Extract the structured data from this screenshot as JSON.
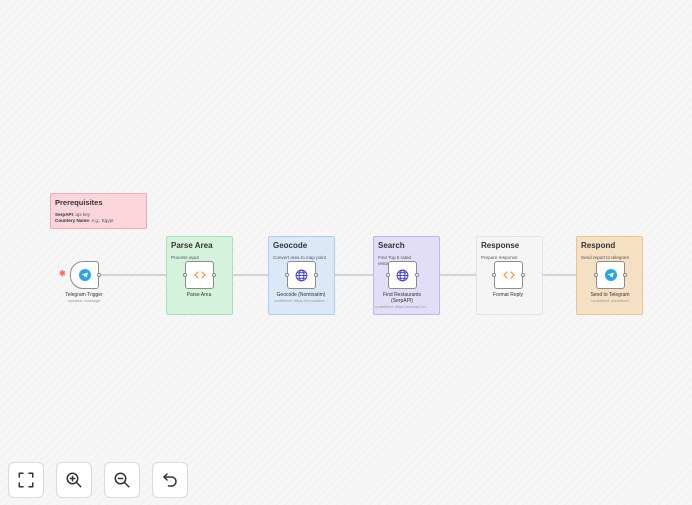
{
  "sticky_notes": {
    "prerequisites": {
      "title": "Prerequisites",
      "line1_label": "SerpAPI",
      "line1_value": ": api key",
      "line2_label": "Countery Name",
      "line2_value": ": e.g.,  Egypt"
    },
    "parse_area": {
      "title": "Parse Area",
      "subtitle": "Process input"
    },
    "geocode": {
      "title": "Geocode",
      "subtitle": "Convert area to map point"
    },
    "search": {
      "title": "Search",
      "subtitle": "Find Top 5 rated restaurants"
    },
    "response": {
      "title": "Response",
      "subtitle": "Prepare response"
    },
    "respond": {
      "title": "Respond",
      "subtitle": "Send report to telegram"
    }
  },
  "nodes": {
    "telegram_trigger": {
      "label": "Telegram Trigger",
      "subtitle": "updates: message",
      "icon": "telegram-icon"
    },
    "parse_area": {
      "label": "Parse Area",
      "icon": "code-icon"
    },
    "geocode": {
      "label": "Geocode (Nominatim)",
      "subtitle": "undefined: https://nominatim...",
      "icon": "globe-icon"
    },
    "find_restaurants": {
      "label_line1": "Find Restaurants",
      "label_line2": "(SerpAPI)",
      "subtitle": "undefined: https://serpapi.co...",
      "icon": "globe-icon"
    },
    "format_reply": {
      "label": "Format Reply",
      "icon": "code-icon"
    },
    "send_to_telegram": {
      "label": "Send to Telegram",
      "subtitle": "undefined: undefined",
      "icon": "telegram-icon"
    }
  },
  "controls": {
    "fit_view": "fit-view-icon",
    "zoom_in": "zoom-in-icon",
    "zoom_out": "zoom-out-icon",
    "undo": "undo-icon"
  },
  "colors": {
    "trigger_star": "#ff6d5a",
    "telegram": "#2ca5e0",
    "code": "#ff8a33",
    "globe": "#3d3fc8"
  }
}
